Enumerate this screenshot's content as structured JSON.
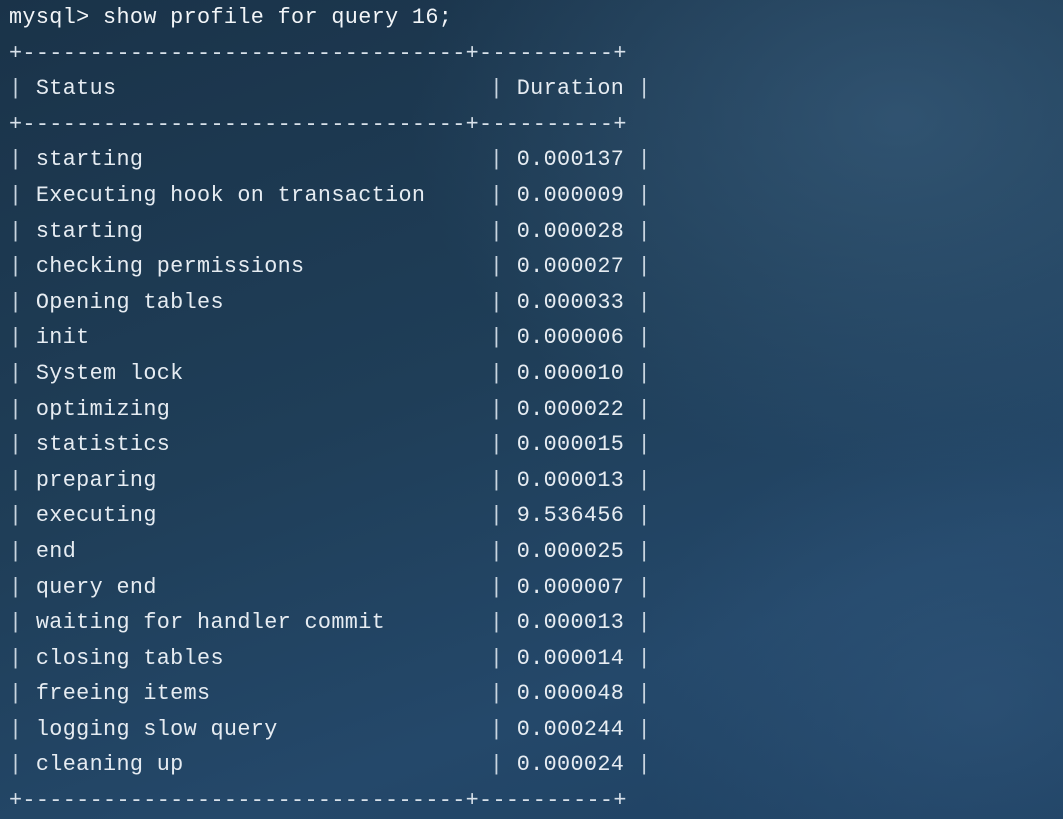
{
  "terminal": {
    "prompt": "mysql>",
    "command": "show profile for query 16;",
    "border": "+---------------------------------+----------+",
    "header": {
      "status": "Status",
      "duration": "Duration"
    },
    "rows": [
      {
        "status": "starting",
        "duration": "0.000137"
      },
      {
        "status": "Executing hook on transaction",
        "duration": "0.000009"
      },
      {
        "status": "starting",
        "duration": "0.000028"
      },
      {
        "status": "checking permissions",
        "duration": "0.000027"
      },
      {
        "status": "Opening tables",
        "duration": "0.000033"
      },
      {
        "status": "init",
        "duration": "0.000006"
      },
      {
        "status": "System lock",
        "duration": "0.000010"
      },
      {
        "status": "optimizing",
        "duration": "0.000022"
      },
      {
        "status": "statistics",
        "duration": "0.000015"
      },
      {
        "status": "preparing",
        "duration": "0.000013"
      },
      {
        "status": "executing",
        "duration": "9.536456"
      },
      {
        "status": "end",
        "duration": "0.000025"
      },
      {
        "status": "query end",
        "duration": "0.000007"
      },
      {
        "status": "waiting for handler commit",
        "duration": "0.000013"
      },
      {
        "status": "closing tables",
        "duration": "0.000014"
      },
      {
        "status": "freeing items",
        "duration": "0.000048"
      },
      {
        "status": "logging slow query",
        "duration": "0.000244"
      },
      {
        "status": "cleaning up",
        "duration": "0.000024"
      }
    ]
  },
  "colors": {
    "background": "#1f3e58",
    "text": "#e6ecf2"
  }
}
